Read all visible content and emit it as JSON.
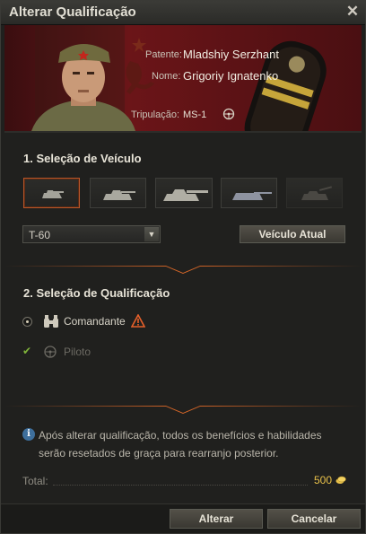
{
  "window": {
    "title": "Alterar Qualificação",
    "close_icon": "close-icon"
  },
  "crew": {
    "rank_label": "Patente:",
    "rank_value": "Mladshiy Serzhant",
    "name_label": "Nome:",
    "name_value": "Grigoriy Ignatenko",
    "crew_label": "Tripulação:",
    "crew_value": "MS-1"
  },
  "vehicle_section": {
    "title": "1. Seleção de Veículo",
    "tanks": [
      {
        "name": "light-tank",
        "selected": true
      },
      {
        "name": "medium-tank",
        "selected": false
      },
      {
        "name": "heavy-tank",
        "selected": false
      },
      {
        "name": "td-tank",
        "selected": false
      },
      {
        "name": "spg-tank",
        "selected": false,
        "disabled": true
      }
    ],
    "dropdown_value": "T-60",
    "current_vehicle_button": "Veículo Atual"
  },
  "qualification_section": {
    "title": "2. Seleção de Qualificação",
    "options": [
      {
        "label": "Comandante",
        "selected": true,
        "warning": true
      },
      {
        "label": "Piloto",
        "current": true
      }
    ]
  },
  "info": {
    "text": "Após alterar qualificação, todos os benefícios e habilidades serão resetados de graça para rearranjo posterior."
  },
  "total": {
    "label": "Total:",
    "value": "500"
  },
  "footer": {
    "apply_button": "Alterar",
    "cancel_button": "Cancelar"
  },
  "colors": {
    "accent": "#c05a22",
    "gold": "#e9c14a",
    "banner_red": "#6b1518"
  }
}
